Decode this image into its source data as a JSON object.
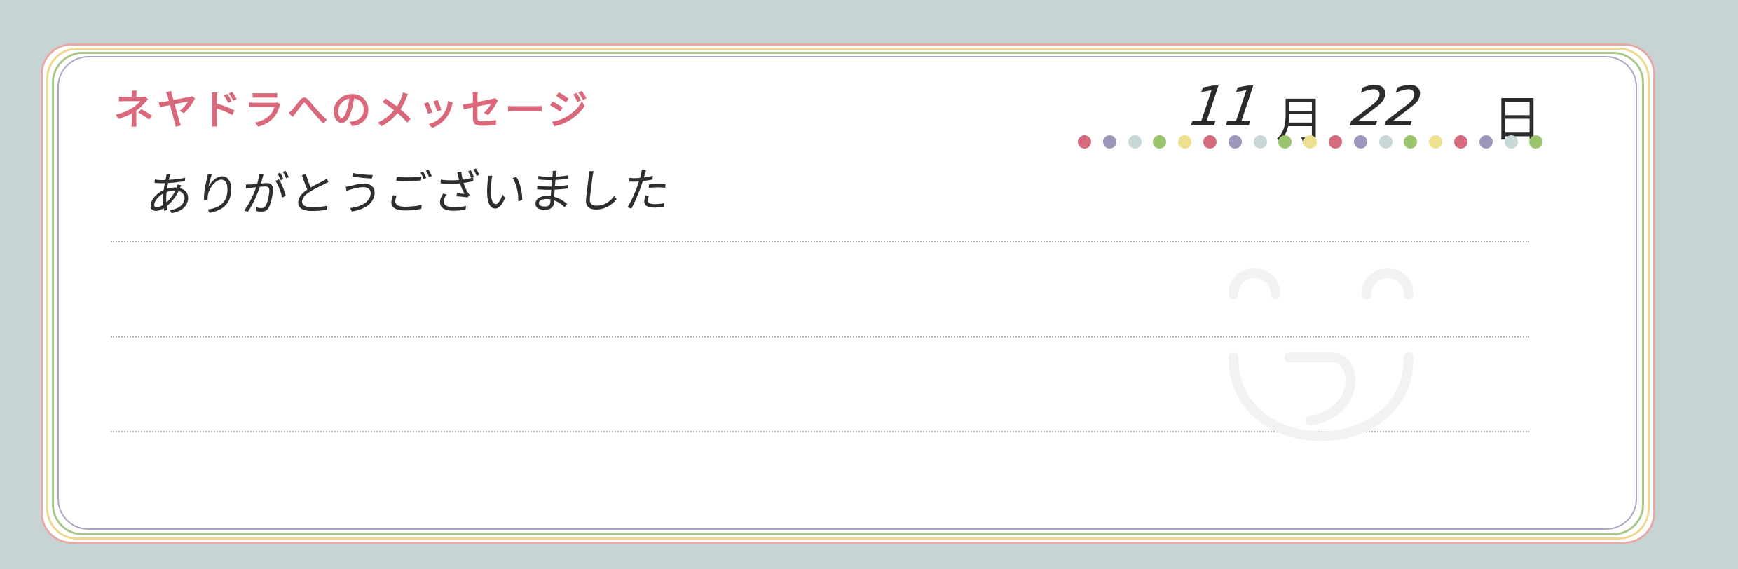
{
  "card": {
    "title": "ネヤドラへのメッセージ",
    "date": {
      "month": "11",
      "month_unit": "月",
      "day": "22",
      "day_unit": "日"
    },
    "message": "ありがとうございました"
  },
  "colors": {
    "background": "#c8d3d3",
    "title": "#d9697a",
    "dots": [
      "#d66b7d",
      "#9d97bb",
      "#c8d8d8",
      "#9bc56d",
      "#ede08e"
    ]
  }
}
